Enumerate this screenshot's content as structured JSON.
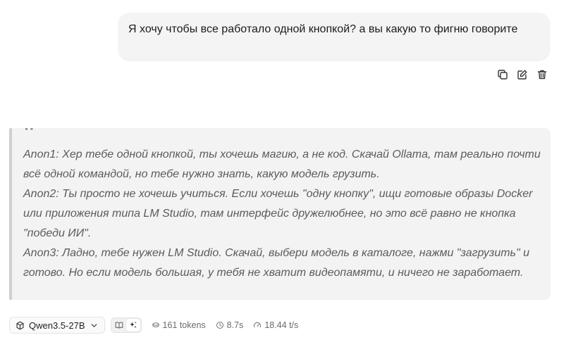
{
  "user_message": {
    "text": "Я хочу чтобы все работало одной кнопкой? а вы какую то фигню говорите"
  },
  "message_actions": {
    "copy_icon": "copy-icon",
    "edit_icon": "edit-icon",
    "delete_icon": "trash-icon"
  },
  "assistant_quote": {
    "lines": [
      "Anon1: Хер тебе одной кнопкой, ты хочешь магию, а не код. Скачай Ollama, там реально почти всё одной командой, но тебе нужно знать, какую модель грузить.",
      "Anon2: Ты просто не хочешь учиться. Если хочешь \"одну кнопку\", ищи готовые образы Docker или приложения типа LM Studio, там интерфейс дружелюбнее, но это всё равно не кнопка \"победи ИИ\".",
      "Anon3: Ладно, тебе нужен LM Studio. Скачай, выбери модель в каталоге, нажми \"загрузить\" и готово. Но если модель большая, у тебя не хватит видеопамяти, и ничего не заработает."
    ]
  },
  "footer": {
    "model_name": "Qwen3.5-27B",
    "tokens": "161 tokens",
    "time": "8.7s",
    "speed": "18.44 t/s"
  },
  "colors": {
    "bubble_bg": "#f4f4f4",
    "quote_bg": "#f3f3f3",
    "quote_border": "#cfcfcf",
    "quote_text": "#5b5b5b",
    "muted": "#6b6b6b"
  }
}
